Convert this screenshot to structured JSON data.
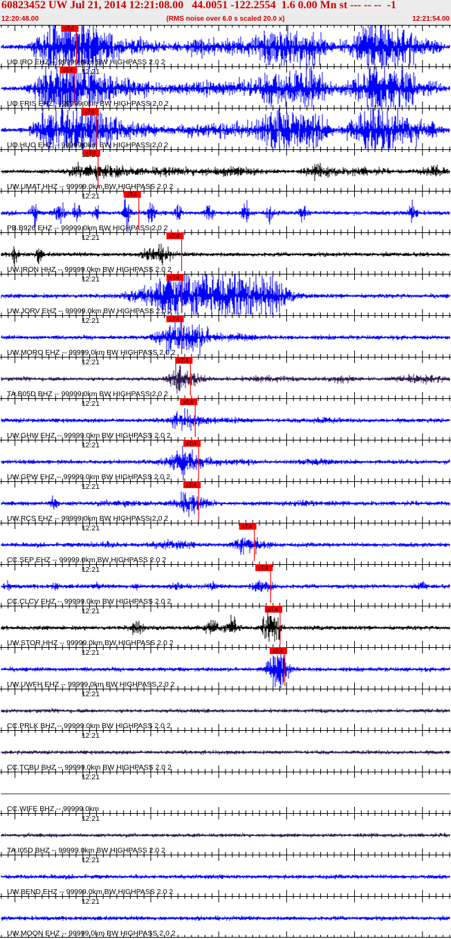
{
  "header": {
    "title": "60823452 UW Jul 21, 2014 12:21:08.00   44.0051 -122.2554  1.6 0.00 Mn st --- -- --  -1",
    "start_time": "12:20:48.00",
    "end_time": "12:21:54.00",
    "rms_note": "(RMS noise over 6.0 s scaled 20.0 x)"
  },
  "colors": {
    "title_red": "#d00000",
    "header_bg": "#ececec",
    "pick_red": "#ff0000",
    "trace_blue": "#0000ff",
    "trace_black": "#000000",
    "trace_purple": "#2e1a52"
  },
  "chart_data": {
    "type": "line",
    "title": "60823452 UW Jul 21, 2014 12:21:08.00   44.0051 -122.2554  1.6 0.00 Mn st --- -- --  -1",
    "x_range_seconds": [
      0,
      66
    ],
    "minute_tick_label": "12:21",
    "minute_tick_seconds": 12,
    "pick_label": "xT:4",
    "traces": [
      {
        "label": "UO.IRO EHZ -- 99999.0km BW  HIGHPASS  2.0  2",
        "color": "blue",
        "pick_s": 8.8,
        "bursts": [
          [
            8.5,
            2.8,
            8.5
          ],
          [
            10.2,
            3,
            7.6
          ],
          [
            14.5,
            2.6,
            5.4
          ],
          [
            19.5,
            2.6,
            2
          ],
          [
            24.5,
            4,
            0.7
          ],
          [
            29.5,
            2.6,
            2
          ],
          [
            34.5,
            2.6,
            2
          ],
          [
            41.5,
            4,
            6
          ],
          [
            46,
            2,
            4
          ],
          [
            55.5,
            4,
            8
          ],
          [
            60,
            1.8,
            3
          ],
          [
            63.5,
            1.2,
            2
          ]
        ]
      },
      {
        "label": "UO.FRIS EHZ -- 99999.0km BW  HIGHPASS  2.0  2",
        "color": "blue",
        "pick_s": 8.6,
        "bursts": [
          [
            8.5,
            2.8,
            8.5
          ],
          [
            10.2,
            3,
            7.6
          ],
          [
            14.5,
            2.6,
            5.4
          ],
          [
            19.5,
            2.6,
            2
          ],
          [
            24.5,
            4,
            0.7
          ],
          [
            29.5,
            2.6,
            2
          ],
          [
            34.5,
            2.6,
            2
          ],
          [
            41.5,
            4,
            6
          ],
          [
            46,
            2,
            4
          ],
          [
            55.5,
            4,
            8
          ],
          [
            60,
            1.8,
            3
          ],
          [
            63.5,
            1.2,
            2
          ]
        ]
      },
      {
        "label": "UO.HUO EHZ -- 99999.0km BW  HIGHPASS  2.0  2",
        "color": "blue",
        "pick_s": 11.8,
        "bursts": [
          [
            8.5,
            2.8,
            8.5
          ],
          [
            10.2,
            3,
            7.6
          ],
          [
            14.5,
            2.6,
            5.4
          ],
          [
            19.5,
            2.6,
            2
          ],
          [
            24.5,
            4,
            0.7
          ],
          [
            29.5,
            2.6,
            2
          ],
          [
            34.5,
            2.6,
            2
          ],
          [
            41.5,
            4,
            6
          ],
          [
            46,
            2,
            4
          ],
          [
            55.5,
            4,
            8
          ],
          [
            60,
            1.8,
            3
          ],
          [
            63.5,
            1.2,
            2
          ]
        ]
      },
      {
        "label": "UW.UMAT HHZ -- 99999.0km BW  HIGHPASS  2.0  2",
        "color": "black",
        "pick_s": 12.0,
        "bursts": [
          [
            12,
            1.5,
            1
          ],
          [
            15,
            4,
            2
          ],
          [
            24,
            3,
            1
          ],
          [
            30,
            3,
            0.7
          ],
          [
            35,
            3,
            1
          ],
          [
            47,
            2,
            1.7
          ],
          [
            53,
            3,
            0.8
          ],
          [
            63.5,
            1.5,
            1.6
          ]
        ]
      },
      {
        "label": "PB.B926 EHZ -- 99999.0km BW  HIGHPASS  2.0  2",
        "color": "blue",
        "pick_s": 18.0,
        "bursts": [
          [
            4.8,
            0.4,
            6
          ],
          [
            8.6,
            0.8,
            4
          ],
          [
            11,
            0.6,
            3
          ],
          [
            14,
            0.6,
            2.5
          ],
          [
            18.5,
            0.5,
            6
          ],
          [
            22,
            0.6,
            3
          ],
          [
            26,
            0.5,
            3
          ],
          [
            30.5,
            0.6,
            3
          ],
          [
            36,
            0.5,
            4
          ],
          [
            39.5,
            0.5,
            2.5
          ],
          [
            44.5,
            0.6,
            2.5
          ],
          [
            60.5,
            0.6,
            3
          ]
        ]
      },
      {
        "label": "UW.IRON HHZ -- 99999.0km BW  HIGHPASS  2.0  2",
        "color": "black",
        "pick_s": 24.3,
        "bursts": [
          [
            2,
            0.4,
            4
          ],
          [
            5.5,
            0.4,
            3
          ],
          [
            22,
            1,
            2
          ],
          [
            24,
            1,
            2.5
          ]
        ]
      },
      {
        "label": "UW.JORV EHZ -- 99999.0km BW  HIGHPASS  2.0  2",
        "color": "blue",
        "pick_s": 24.3,
        "bursts": [
          [
            22,
            3,
            1.5
          ],
          [
            25,
            1.5,
            4
          ],
          [
            31,
            7,
            9
          ],
          [
            36,
            4,
            5
          ],
          [
            39.5,
            2,
            3
          ]
        ]
      },
      {
        "label": "UW.MORO EHZ -- 99999.0km BW  HIGHPASS  2.0  2",
        "color": "blue",
        "pick_s": 24.3,
        "bursts": [
          [
            24.5,
            1.5,
            3
          ],
          [
            27,
            3,
            3
          ],
          [
            29,
            2,
            2
          ],
          [
            34,
            4,
            0.7
          ]
        ]
      },
      {
        "label": "TA.B05D BHZ -- 99999.0km BW  HIGHPASS  2.0  2",
        "color": "purple",
        "pick_s": 25.6,
        "bursts": [
          [
            26,
            1.2,
            3
          ],
          [
            28,
            2,
            2
          ],
          [
            39,
            3,
            0.6
          ],
          [
            50,
            2,
            0.8
          ],
          [
            62,
            3,
            1
          ]
        ]
      },
      {
        "label": "UW.GHW EHZ -- 99999.0km BW  HIGHPASS  2.0  2",
        "color": "blue",
        "pick_s": 26.3,
        "bursts": [
          [
            26.5,
            1.5,
            2
          ],
          [
            28,
            2,
            1
          ],
          [
            33,
            3,
            0.5
          ],
          [
            47,
            2,
            0.6
          ]
        ]
      },
      {
        "label": "UW.GPW EHZ -- 99999.0km BW  HIGHPASS  2.0  2",
        "color": "blue",
        "pick_s": 26.8,
        "bursts": [
          [
            25,
            2,
            1
          ],
          [
            27,
            1.5,
            3.5
          ],
          [
            29,
            2,
            1.5
          ],
          [
            34,
            3,
            0.6
          ],
          [
            47,
            2,
            0.6
          ]
        ]
      },
      {
        "label": "UW.RCS EHZ -- 99999.0km BW  HIGHPASS  2.0  2",
        "color": "blue",
        "pick_s": 26.8,
        "bursts": [
          [
            7.8,
            0.6,
            2
          ],
          [
            27.2,
            1.5,
            3.5
          ],
          [
            29.5,
            1.5,
            1.2
          ],
          [
            18,
            3,
            0.6
          ],
          [
            45,
            3,
            0.5
          ]
        ]
      },
      {
        "label": "CC.SEP EHZ -- 99999.0km BW  HIGHPASS  2.0  2",
        "color": "blue",
        "pick_s": 35.0,
        "bursts": [
          [
            25,
            3,
            0.9
          ],
          [
            35.5,
            1.5,
            2
          ],
          [
            37.5,
            2,
            1.2
          ],
          [
            15,
            3,
            0.5
          ]
        ]
      },
      {
        "label": "CC.CLCV EHZ -- 99999.0km BW  HIGHPASS  2.0  2",
        "color": "blue",
        "pick_s": 37.4,
        "bursts": [
          [
            1,
            0.5,
            1
          ],
          [
            8,
            0.5,
            0.8
          ],
          [
            14,
            0.6,
            0.8
          ],
          [
            20,
            0.5,
            0.7
          ],
          [
            26,
            0.6,
            1
          ],
          [
            31,
            0.6,
            0.9
          ],
          [
            37.8,
            0.8,
            2
          ],
          [
            39.5,
            0.8,
            1.3
          ],
          [
            62,
            0.6,
            1.2
          ]
        ]
      },
      {
        "label": "UW.STOR HHZ -- 99999.0km BW  HIGHPASS  2.0  2",
        "color": "black",
        "pick_s": 38.8,
        "bursts": [
          [
            20,
            1,
            2
          ],
          [
            31,
            1,
            2.5
          ],
          [
            34,
            1,
            3
          ],
          [
            39.5,
            1,
            5
          ],
          [
            40.5,
            0.8,
            3.5
          ]
        ]
      },
      {
        "label": "UW.UWFH EHZ -- 99999.0km BW  HIGHPASS  2.0  2",
        "color": "blue",
        "pick_s": 39.5,
        "bursts": [
          [
            40.5,
            1.3,
            5
          ],
          [
            41.5,
            1,
            3
          ]
        ]
      },
      {
        "label": "CC.PRLK BHZ -- 99999.0km BW  HIGHPASS  2.0  2",
        "color": "purple",
        "pick_s": null,
        "bursts": []
      },
      {
        "label": "CC.TCBU BHZ -- 99999.0km BW  HIGHPASS  2.0  2",
        "color": "purple",
        "pick_s": null,
        "bursts": []
      },
      {
        "label": "CC.WIFE BHZ -- 99999.0km",
        "color": "purple",
        "pick_s": null,
        "bursts": [],
        "flat": true
      },
      {
        "label": "TA.I05D BHZ -- 99999.0km BW  HIGHPASS  2.0  2",
        "color": "purple",
        "pick_s": null,
        "bursts": []
      },
      {
        "label": "UW.BEND EHZ -- 99999.0km BW  HIGHPASS  2.0  2",
        "color": "blue",
        "pick_s": null,
        "bursts": []
      },
      {
        "label": "UW.MOON EHZ -- 99999.0km BW  HIGHPASS  2.0  2",
        "color": "blue",
        "pick_s": null,
        "bursts": []
      }
    ]
  }
}
